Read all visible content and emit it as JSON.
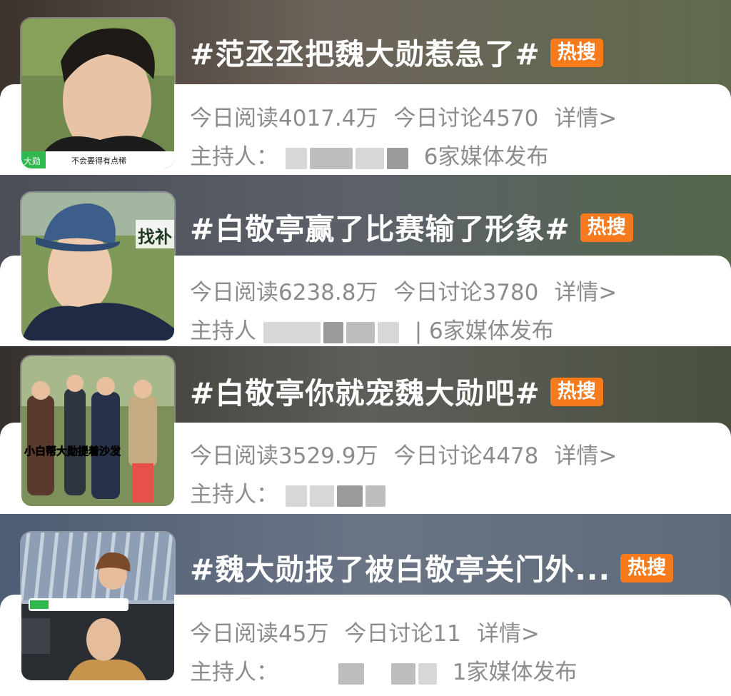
{
  "topics": [
    {
      "title": "#范丞丞把魏大勋惹急了#",
      "badge": "热搜",
      "reads": "今日阅读4017.4万",
      "discussion": "今日讨论4570",
      "details": "详情>",
      "host_label": "主持人：",
      "media": "6家媒体发布",
      "thumb_caption": "不会要得有点稀",
      "thumb_tag": "大勋"
    },
    {
      "title": "#白敬亭赢了比赛输了形象#",
      "badge": "热搜",
      "reads": "今日阅读6238.8万",
      "discussion": "今日讨论3780",
      "details": "详情>",
      "host_label": "主持人",
      "media": "| 6家媒体发布",
      "thumb_overlay": "找补"
    },
    {
      "title": "#白敬亭你就宠魏大勋吧#",
      "badge": "热搜",
      "reads": "今日阅读3529.9万",
      "discussion": "今日讨论4478",
      "details": "详情>",
      "host_label": "主持人：",
      "thumb_caption": "小白帮大勋提着沙发"
    },
    {
      "title": "#魏大勋报了被白敬亭关门外...",
      "badge": "热搜",
      "reads": "今日阅读45万",
      "discussion": "今日讨论11",
      "details": "详情>",
      "host_label": "主持人：",
      "media": "1家媒体发布"
    }
  ],
  "colors": {
    "badge": "#f77b1c",
    "stats_text": "#8c8c8c",
    "title_text": "#ffffff"
  }
}
